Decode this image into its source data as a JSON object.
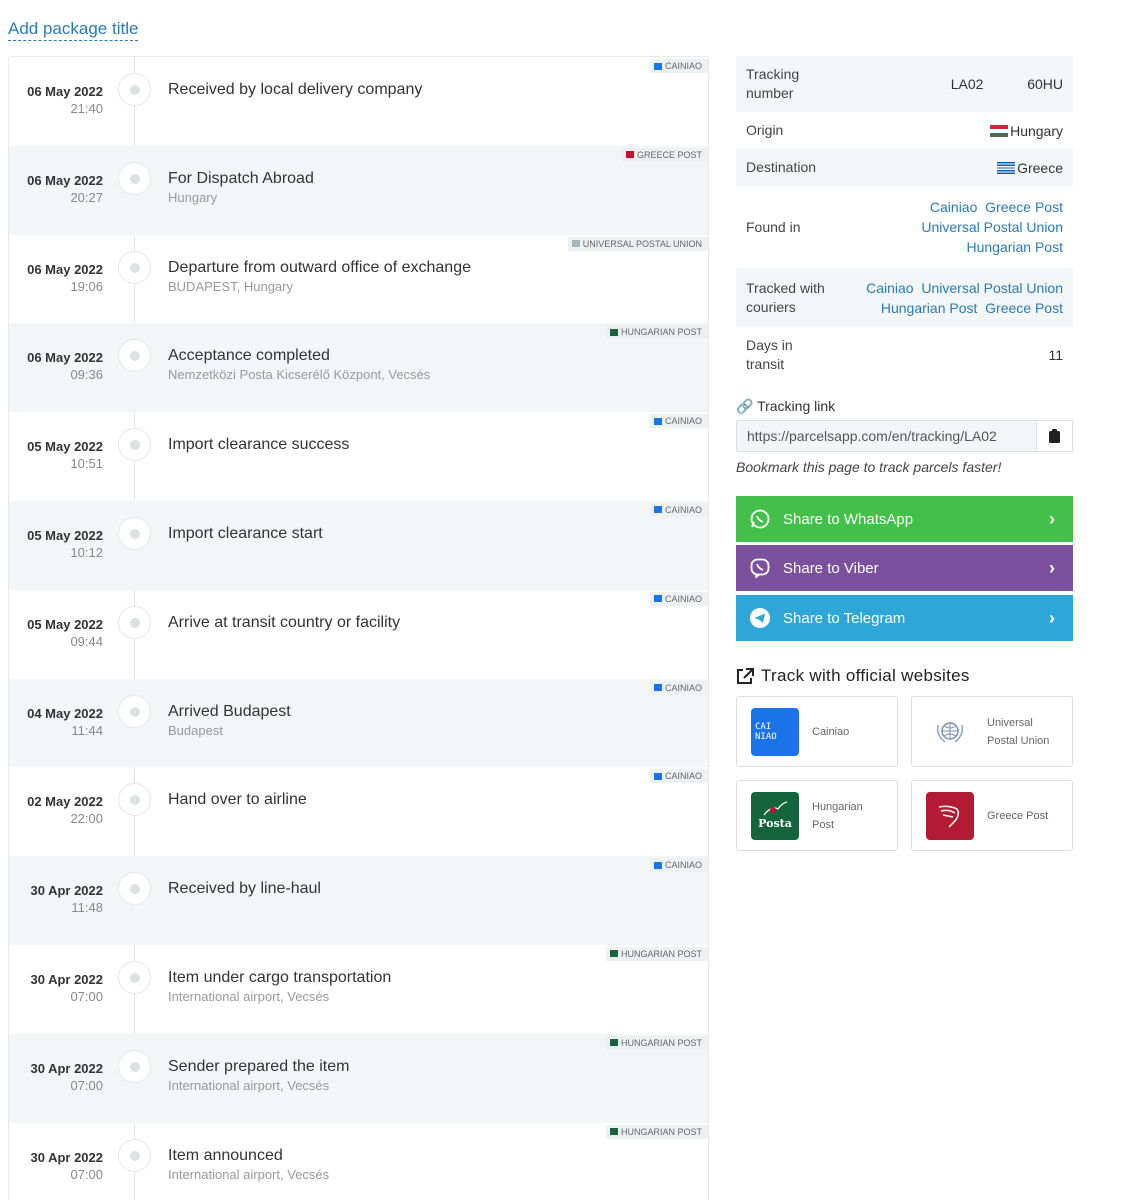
{
  "header": {
    "add_title": "Add package title"
  },
  "events": [
    {
      "date": "06 May 2022",
      "time": "21:40",
      "title": "Received by local delivery company",
      "location": "",
      "courier": "CAINIAO",
      "courier_color": "#1a73e8"
    },
    {
      "date": "06 May 2022",
      "time": "20:27",
      "title": "For Dispatch Abroad",
      "location": "Hungary",
      "courier": "GREECE POST",
      "courier_color": "#c8102e"
    },
    {
      "date": "06 May 2022",
      "time": "19:06",
      "title": "Departure from outward office of exchange",
      "location": "BUDAPEST, Hungary",
      "courier": "UNIVERSAL POSTAL UNION",
      "courier_color": "#aab4bd"
    },
    {
      "date": "06 May 2022",
      "time": "09:36",
      "title": "Acceptance completed",
      "location": "Nemzetközi Posta Kicserélő Központ, Vecsés",
      "courier": "HUNGARIAN POST",
      "courier_color": "#14643c"
    },
    {
      "date": "05 May 2022",
      "time": "10:51",
      "title": "Import clearance success",
      "location": "",
      "courier": "CAINIAO",
      "courier_color": "#1a73e8"
    },
    {
      "date": "05 May 2022",
      "time": "10:12",
      "title": "Import clearance start",
      "location": "",
      "courier": "CAINIAO",
      "courier_color": "#1a73e8"
    },
    {
      "date": "05 May 2022",
      "time": "09:44",
      "title": "Arrive at transit country or facility",
      "location": "",
      "courier": "CAINIAO",
      "courier_color": "#1a73e8"
    },
    {
      "date": "04 May 2022",
      "time": "11:44",
      "title": "Arrived Budapest",
      "location": "Budapest",
      "courier": "CAINIAO",
      "courier_color": "#1a73e8"
    },
    {
      "date": "02 May 2022",
      "time": "22:00",
      "title": "Hand over to airline",
      "location": "",
      "courier": "CAINIAO",
      "courier_color": "#1a73e8"
    },
    {
      "date": "30 Apr 2022",
      "time": "11:48",
      "title": "Received by line-haul",
      "location": "",
      "courier": "CAINIAO",
      "courier_color": "#1a73e8"
    },
    {
      "date": "30 Apr 2022",
      "time": "07:00",
      "title": "Item under cargo transportation",
      "location": "International airport, Vecsés",
      "courier": "HUNGARIAN POST",
      "courier_color": "#14643c"
    },
    {
      "date": "30 Apr 2022",
      "time": "07:00",
      "title": "Sender prepared the item",
      "location": "International airport, Vecsés",
      "courier": "HUNGARIAN POST",
      "courier_color": "#14643c"
    },
    {
      "date": "30 Apr 2022",
      "time": "07:00",
      "title": "Item announced",
      "location": "International airport, Vecsés",
      "courier": "HUNGARIAN POST",
      "courier_color": "#14643c"
    }
  ],
  "info": {
    "tracking_label": "Tracking number",
    "tracking_value_a": "LA02",
    "tracking_value_b": "60HU",
    "origin_label": "Origin",
    "origin_value": "Hungary",
    "destination_label": "Destination",
    "destination_value": "Greece",
    "found_label": "Found in",
    "found_links": [
      "Cainiao",
      "Greece Post",
      "Universal Postal Union",
      "Hungarian Post"
    ],
    "couriers_label": "Tracked with couriers",
    "courier_links": [
      "Cainiao",
      "Universal Postal Union",
      "Hungarian Post",
      "Greece Post"
    ],
    "days_label": "Days in transit",
    "days_value": "11"
  },
  "tracking_link": {
    "label": "Tracking link",
    "url": "https://parcelsapp.com/en/tracking/LA02",
    "bookmark_hint": "Bookmark this page to track parcels faster!"
  },
  "share": {
    "whatsapp": "Share to WhatsApp",
    "viber": "Share to Viber",
    "telegram": "Share to Telegram",
    "colors": {
      "whatsapp": "#43bf4a",
      "viber": "#7b519d",
      "telegram": "#2ea6d8"
    }
  },
  "official": {
    "heading": "Track with official websites",
    "cards": [
      {
        "name_l1": "Cainiao",
        "name_l2": "",
        "logo_text": "CAI NIAO",
        "color": "#1a73e8"
      },
      {
        "name_l1": "Universal",
        "name_l2": "Postal Union",
        "logo_text": "",
        "color": "#ffffff"
      },
      {
        "name_l1": "Hungarian",
        "name_l2": "Post",
        "logo_text": "Posta",
        "color": "#14643c"
      },
      {
        "name_l1": "Greece Post",
        "name_l2": "",
        "logo_text": "",
        "color": "#b31b34"
      }
    ]
  },
  "colors": {
    "link": "#2a7ab8",
    "alt_row": "#f3f6f7"
  }
}
